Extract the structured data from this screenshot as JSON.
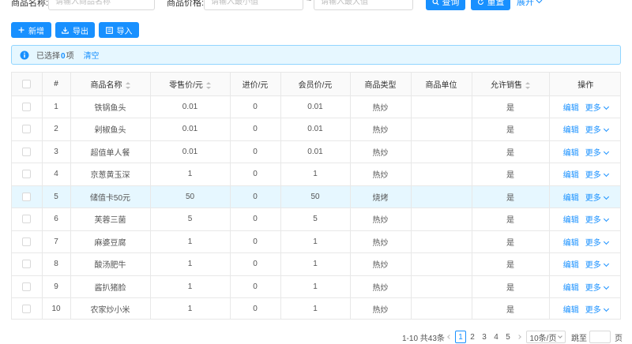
{
  "search": {
    "name_label": "商品名称:",
    "name_placeholder": "请输入商品名称",
    "price_label": "商品价格:",
    "min_placeholder": "请输入最小值",
    "range_sep": "~",
    "max_placeholder": "请输入最大值",
    "query_label": "查询",
    "reset_label": "重置",
    "expand_label": "展开"
  },
  "toolbar": {
    "add_label": "新增",
    "export_label": "导出",
    "import_label": "导入"
  },
  "selection": {
    "prefix": "已选择",
    "count": "0",
    "suffix": "项",
    "clear_label": "清空"
  },
  "table": {
    "headers": {
      "index": "#",
      "name": "商品名称",
      "retail": "零售价/元",
      "cost": "进价/元",
      "member": "会员价/元",
      "type": "商品类型",
      "unit": "商品单位",
      "allow": "允许销售",
      "ops": "操作"
    },
    "edit_label": "编辑",
    "more_label": "更多",
    "rows": [
      {
        "index": "1",
        "name": "铁锅鱼头",
        "retail": "0.01",
        "cost": "0",
        "member": "0.01",
        "type": "热炒",
        "unit": "",
        "allow": "是"
      },
      {
        "index": "2",
        "name": "剁椒鱼头",
        "retail": "0.01",
        "cost": "0",
        "member": "0.01",
        "type": "热炒",
        "unit": "",
        "allow": "是"
      },
      {
        "index": "3",
        "name": "超值单人餐",
        "retail": "0.01",
        "cost": "0",
        "member": "0.01",
        "type": "热炒",
        "unit": "",
        "allow": "是"
      },
      {
        "index": "4",
        "name": "京葱黄玉深",
        "retail": "1",
        "cost": "0",
        "member": "1",
        "type": "热炒",
        "unit": "",
        "allow": "是"
      },
      {
        "index": "5",
        "name": "储值卡50元",
        "retail": "50",
        "cost": "0",
        "member": "50",
        "type": "烧烤",
        "unit": "",
        "allow": "是"
      },
      {
        "index": "6",
        "name": "芙蓉三菌",
        "retail": "5",
        "cost": "0",
        "member": "5",
        "type": "热炒",
        "unit": "",
        "allow": "是"
      },
      {
        "index": "7",
        "name": "麻婆豆腐",
        "retail": "1",
        "cost": "0",
        "member": "1",
        "type": "热炒",
        "unit": "",
        "allow": "是"
      },
      {
        "index": "8",
        "name": "酸汤肥牛",
        "retail": "1",
        "cost": "0",
        "member": "1",
        "type": "热炒",
        "unit": "",
        "allow": "是"
      },
      {
        "index": "9",
        "name": "酱扒猪脸",
        "retail": "1",
        "cost": "0",
        "member": "1",
        "type": "热炒",
        "unit": "",
        "allow": "是"
      },
      {
        "index": "10",
        "name": "农家炒小米",
        "retail": "1",
        "cost": "0",
        "member": "1",
        "type": "热炒",
        "unit": "",
        "allow": "是"
      }
    ]
  },
  "pagination": {
    "summary": "1-10 共43条",
    "pages": [
      "1",
      "2",
      "3",
      "4",
      "5"
    ],
    "page_size_label": "10条/页",
    "jump_prefix": "跳至",
    "jump_suffix": "页"
  }
}
